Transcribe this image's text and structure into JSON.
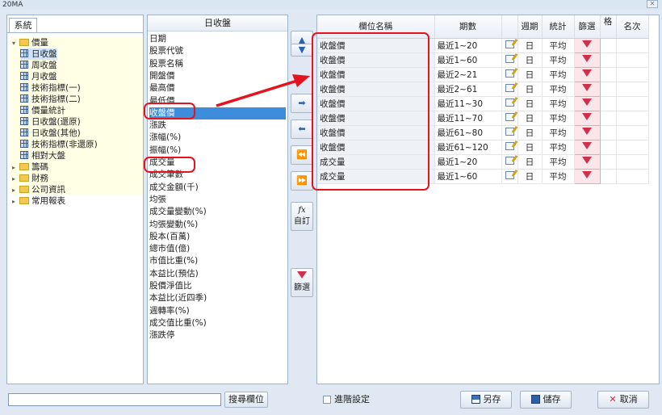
{
  "window": {
    "title": "20MA",
    "close_glyph": "✕"
  },
  "tree": {
    "tab_label": "系統",
    "nodes": [
      {
        "label": "價量",
        "kind": "folder-open",
        "indent": 0
      },
      {
        "label": "日收盤",
        "kind": "table",
        "indent": 1,
        "selected": true
      },
      {
        "label": "周收盤",
        "kind": "table",
        "indent": 1
      },
      {
        "label": "月收盤",
        "kind": "table",
        "indent": 1
      },
      {
        "label": "技術指標(一)",
        "kind": "table",
        "indent": 1
      },
      {
        "label": "技術指標(二)",
        "kind": "table",
        "indent": 1
      },
      {
        "label": "價量統計",
        "kind": "table",
        "indent": 1
      },
      {
        "label": "日收盤(還原)",
        "kind": "table",
        "indent": 1
      },
      {
        "label": "日收盤(其他)",
        "kind": "table",
        "indent": 1
      },
      {
        "label": "技術指標(非還原)",
        "kind": "table",
        "indent": 1
      },
      {
        "label": "相對大盤",
        "kind": "table",
        "indent": 1
      },
      {
        "label": "籌碼",
        "kind": "folder",
        "indent": 0
      },
      {
        "label": "財務",
        "kind": "folder",
        "indent": 0
      },
      {
        "label": "公司資訊",
        "kind": "folder",
        "indent": 0
      },
      {
        "label": "常用報表",
        "kind": "folder",
        "indent": 0
      }
    ]
  },
  "field_list": {
    "header": "日收盤",
    "items": [
      "日期",
      "股票代號",
      "股票名稱",
      "開盤價",
      "最高價",
      "最低價",
      "收盤價",
      "漲跌",
      "漲幅(%)",
      "振幅(%)",
      "成交量",
      "成交筆數",
      "成交金額(千)",
      "均張",
      "成交量變動(%)",
      "均張變動(%)",
      "股本(百萬)",
      "總市值(億)",
      "市值比重(%)",
      "本益比(預估)",
      "股價淨值比",
      "本益比(近四季)",
      "週轉率(%)",
      "成交值比重(%)",
      "漲跌停"
    ],
    "selected_index": 6
  },
  "mid_buttons": {
    "up": "▲",
    "down": "▼",
    "add": "➡",
    "remove": "⬅",
    "remove_all": "⏪",
    "add_all": "⏩",
    "custom_icon": "fx",
    "custom_label": "自訂",
    "filter_label": "篩選"
  },
  "grid": {
    "columns": [
      "欄位名稱",
      "期數",
      "",
      "週期",
      "統計",
      "篩選",
      "格",
      "名次"
    ],
    "rows": [
      {
        "name": "收盤價",
        "period": "最近1~20",
        "cycle": "日",
        "stat": "平均"
      },
      {
        "name": "收盤價",
        "period": "最近1~60",
        "cycle": "日",
        "stat": "平均"
      },
      {
        "name": "收盤價",
        "period": "最近2~21",
        "cycle": "日",
        "stat": "平均"
      },
      {
        "name": "收盤價",
        "period": "最近2~61",
        "cycle": "日",
        "stat": "平均"
      },
      {
        "name": "收盤價",
        "period": "最近11~30",
        "cycle": "日",
        "stat": "平均"
      },
      {
        "name": "收盤價",
        "period": "最近11~70",
        "cycle": "日",
        "stat": "平均"
      },
      {
        "name": "收盤價",
        "period": "最近61~80",
        "cycle": "日",
        "stat": "平均"
      },
      {
        "name": "收盤價",
        "period": "最近61~120",
        "cycle": "日",
        "stat": "平均"
      },
      {
        "name": "成交量",
        "period": "最近1~20",
        "cycle": "日",
        "stat": "平均"
      },
      {
        "name": "成交量",
        "period": "最近1~60",
        "cycle": "日",
        "stat": "平均"
      }
    ]
  },
  "bottom": {
    "search_value": "",
    "search_button": "搜尋欄位",
    "advanced_label": "進階設定",
    "saveas_label": "另存",
    "save_label": "儲存",
    "cancel_label": "取消"
  },
  "colors": {
    "annotation": "#e5131d",
    "selection": "#3e8ddd",
    "tree_bg": "#ffffe6"
  }
}
